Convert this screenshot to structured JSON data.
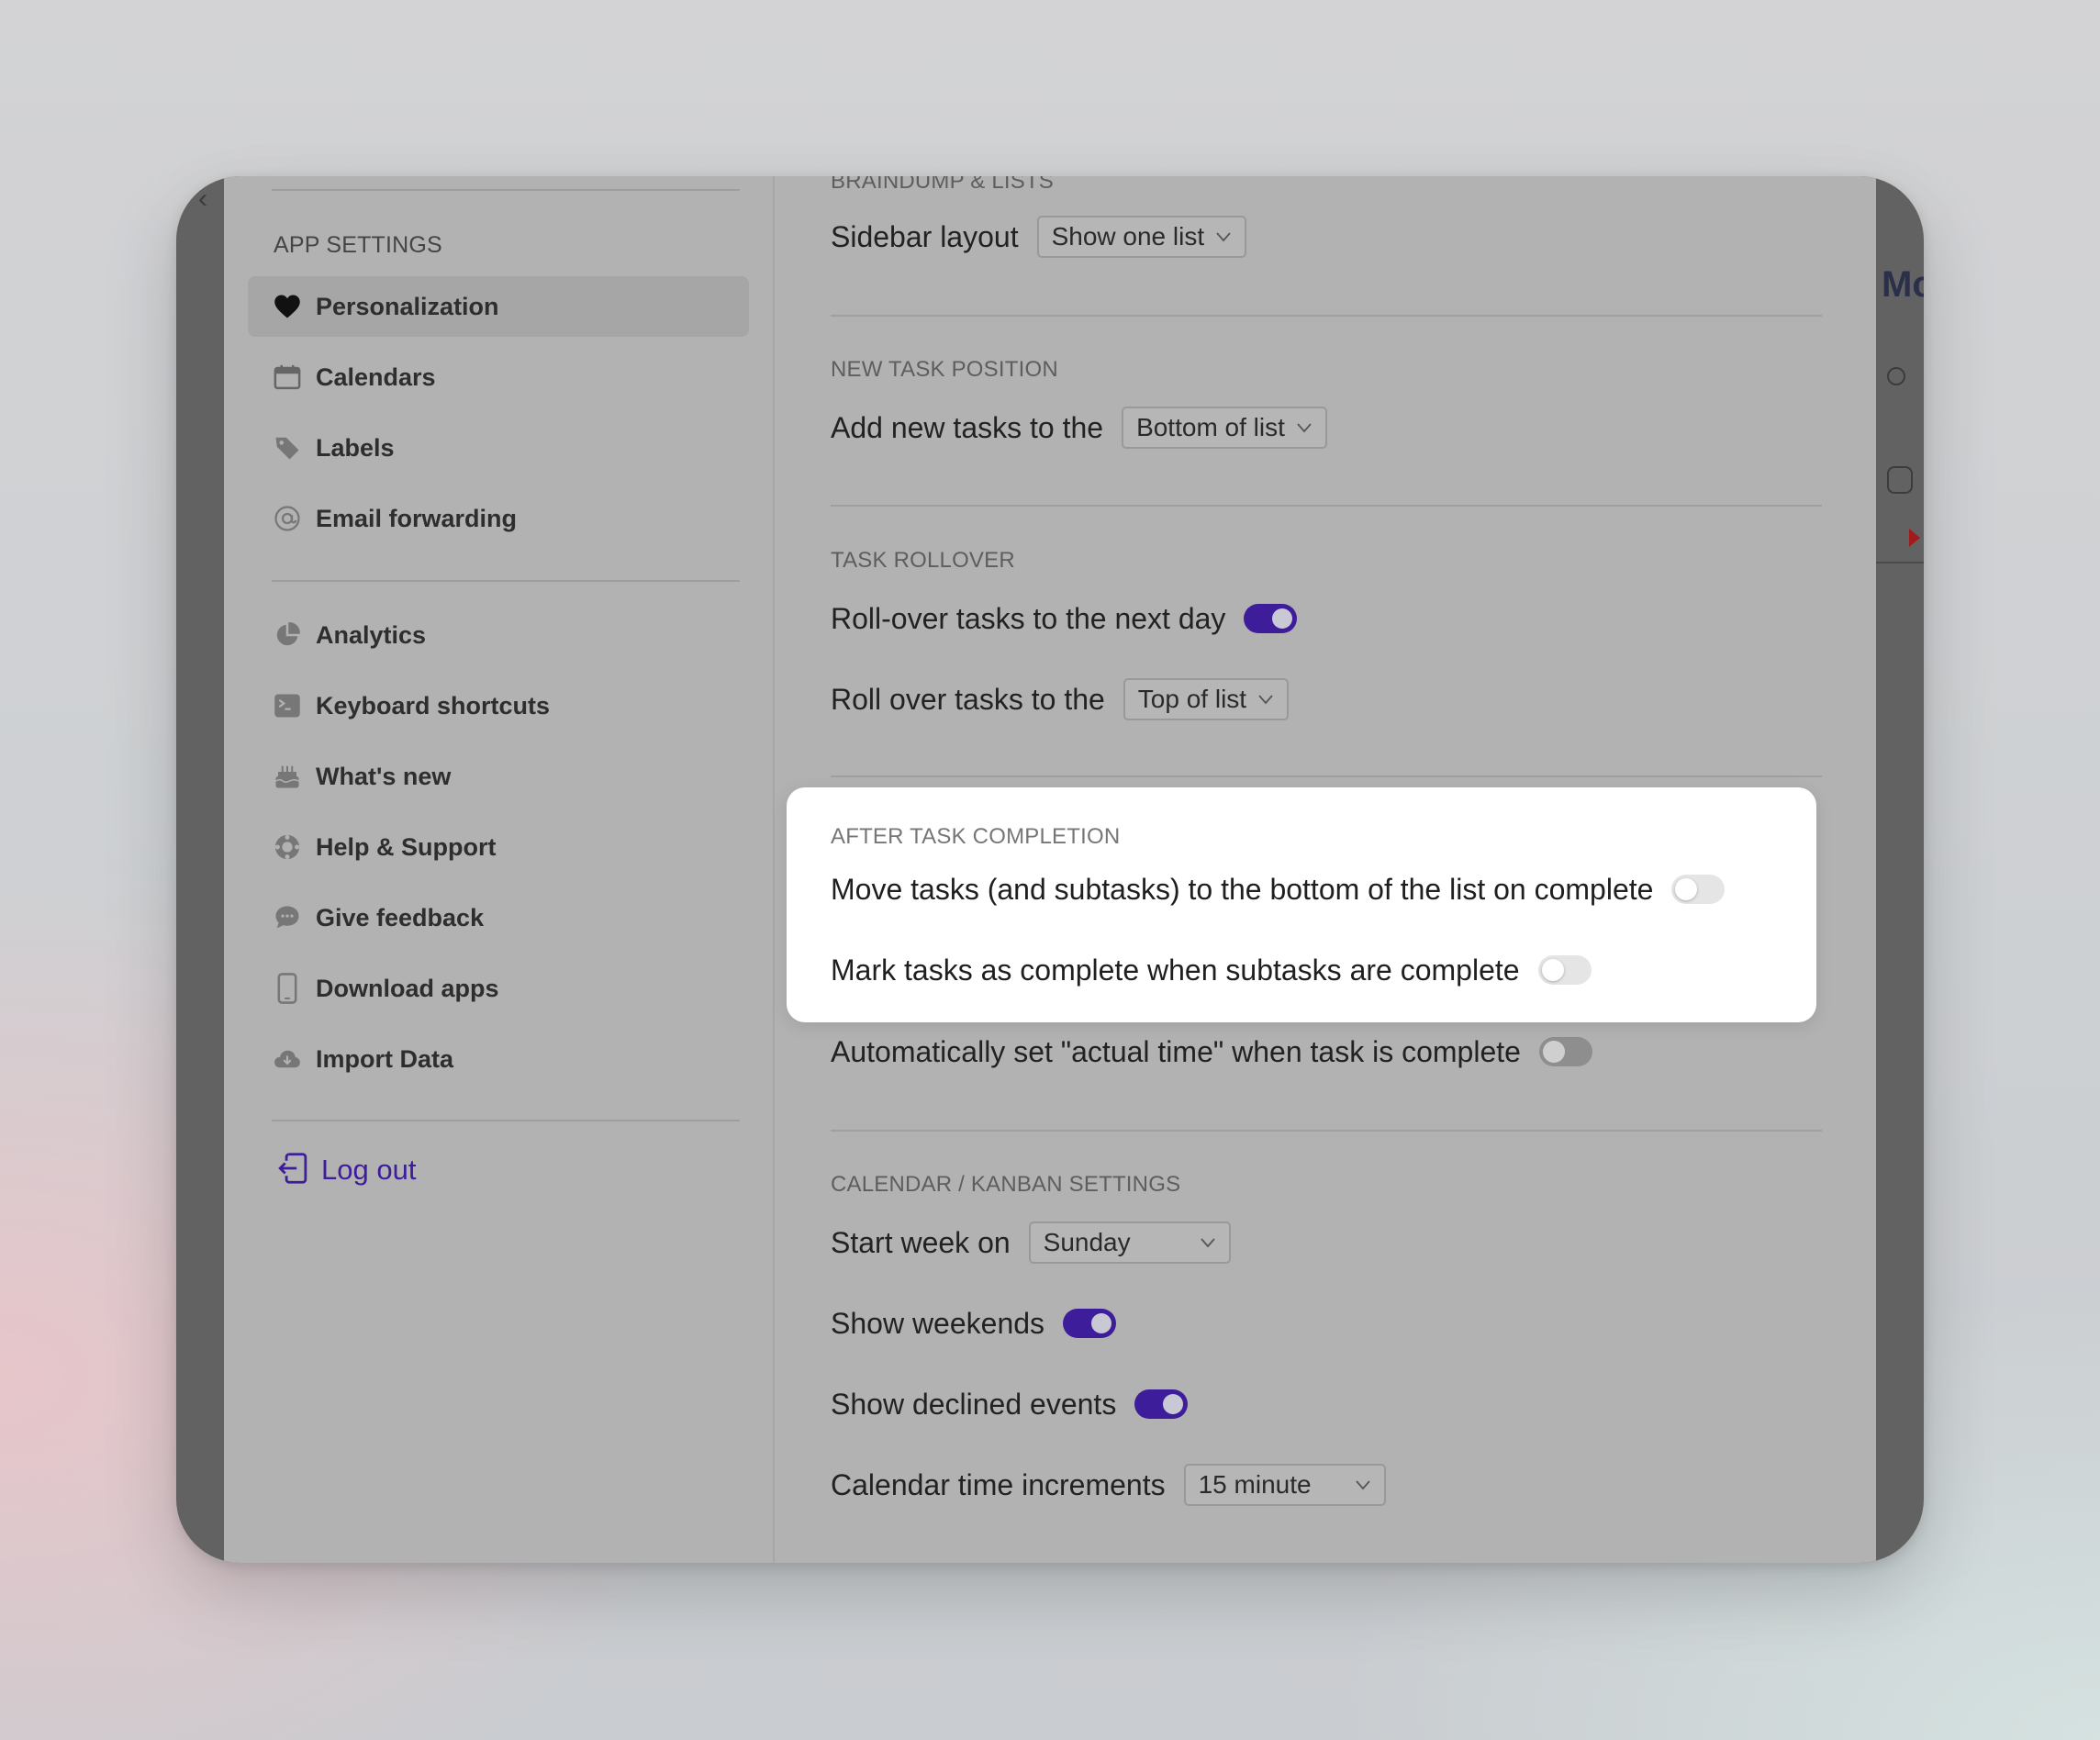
{
  "background_window": {
    "back_glyph": "‹",
    "partial_title": "Mc"
  },
  "sidebar": {
    "heading": "APP SETTINGS",
    "group1": [
      {
        "label": "Personalization",
        "icon": "heart-icon",
        "active": true
      },
      {
        "label": "Calendars",
        "icon": "calendar-icon"
      },
      {
        "label": "Labels",
        "icon": "tag-icon"
      },
      {
        "label": "Email forwarding",
        "icon": "at-icon"
      }
    ],
    "group2": [
      {
        "label": "Analytics",
        "icon": "pie-chart-icon"
      },
      {
        "label": "Keyboard shortcuts",
        "icon": "terminal-icon"
      },
      {
        "label": "What's new",
        "icon": "cake-icon"
      },
      {
        "label": "Help & Support",
        "icon": "lifebuoy-icon"
      },
      {
        "label": "Give feedback",
        "icon": "chat-bubble-icon"
      },
      {
        "label": "Download apps",
        "icon": "phone-icon"
      },
      {
        "label": "Import Data",
        "icon": "cloud-download-icon"
      }
    ],
    "logout_label": "Log out"
  },
  "settings": {
    "braindump": {
      "title": "BRAINDUMP & LISTS",
      "sidebar_layout_label": "Sidebar layout",
      "sidebar_layout_value": "Show one list"
    },
    "new_task_position": {
      "title": "NEW TASK POSITION",
      "add_new_label": "Add new tasks to the",
      "add_new_value": "Bottom of list"
    },
    "task_rollover": {
      "title": "TASK ROLLOVER",
      "rollover_label": "Roll-over tasks to the next day",
      "rollover_on": true,
      "rollover_position_label": "Roll over tasks to the",
      "rollover_position_value": "Top of list"
    },
    "after_completion": {
      "title": "AFTER TASK COMPLETION",
      "move_label": "Move tasks (and subtasks) to the bottom of the list on complete",
      "move_on": false,
      "mark_label": "Mark tasks as complete when subtasks are complete",
      "mark_on": false,
      "actual_time_label": "Automatically set \"actual time\" when task is complete",
      "actual_time_on": false
    },
    "calendar": {
      "title": "CALENDAR / KANBAN SETTINGS",
      "start_week_label": "Start week on",
      "start_week_value": "Sunday",
      "weekends_label": "Show weekends",
      "weekends_on": true,
      "declined_label": "Show declined events",
      "declined_on": true,
      "increments_label": "Calendar time increments",
      "increments_value": "15 minute"
    }
  },
  "colors": {
    "accent": "#3d1d9a",
    "modal_bg": "#b2b2b2",
    "highlight_bg": "#ffffff"
  }
}
